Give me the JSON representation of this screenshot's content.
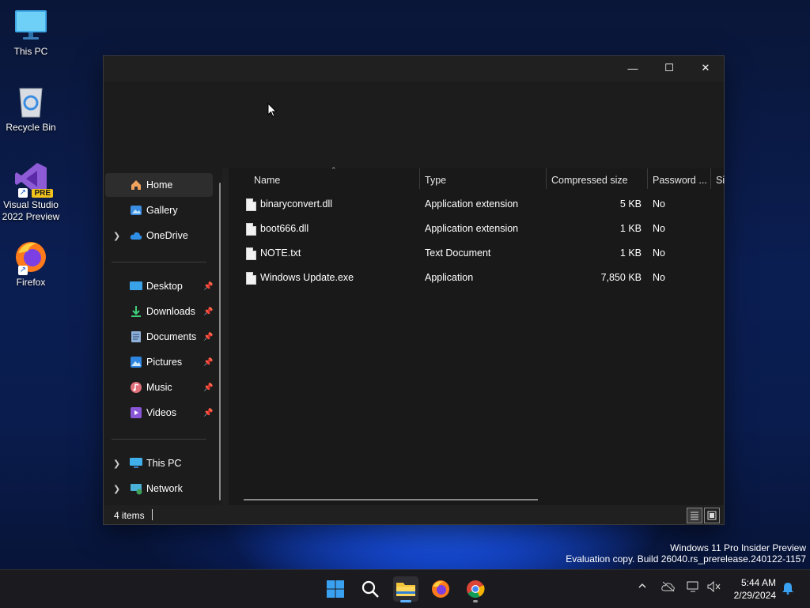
{
  "desktop": {
    "icons": [
      {
        "label_line1": "This PC",
        "label_line2": ""
      },
      {
        "label_line1": "Recycle Bin",
        "label_line2": ""
      },
      {
        "label_line1": "Visual Studio",
        "label_line2": "2022 Preview",
        "badge": "PRE"
      },
      {
        "label_line1": "Firefox",
        "label_line2": ""
      }
    ]
  },
  "window": {
    "controls": {
      "minimize": "—",
      "maximize": "☐",
      "close": "✕"
    },
    "nav": {
      "items": [
        {
          "label": "Home"
        },
        {
          "label": "Gallery"
        },
        {
          "label": "OneDrive"
        },
        {
          "label": "Desktop"
        },
        {
          "label": "Downloads"
        },
        {
          "label": "Documents"
        },
        {
          "label": "Pictures"
        },
        {
          "label": "Music"
        },
        {
          "label": "Videos"
        },
        {
          "label": "This PC"
        },
        {
          "label": "Network"
        }
      ]
    },
    "columns": {
      "name": "Name",
      "type": "Type",
      "compressed_size": "Compressed size",
      "password": "Password ...",
      "size": "Si"
    },
    "files": [
      {
        "name": "binaryconvert.dll",
        "type": "Application extension",
        "compressed_size": "5 KB",
        "password": "No"
      },
      {
        "name": "boot666.dll",
        "type": "Application extension",
        "compressed_size": "1 KB",
        "password": "No"
      },
      {
        "name": "NOTE.txt",
        "type": "Text Document",
        "compressed_size": "1 KB",
        "password": "No"
      },
      {
        "name": "Windows Update.exe",
        "type": "Application",
        "compressed_size": "7,850 KB",
        "password": "No"
      }
    ],
    "status": {
      "item_count": "4 items"
    }
  },
  "watermark": {
    "line1": "Windows 11 Pro Insider Preview",
    "line2": "Evaluation copy. Build 26040.rs_prerelease.240122-1157"
  },
  "taskbar": {
    "clock": {
      "time": "5:44 AM",
      "date": "2/29/2024"
    }
  },
  "colors": {
    "accent": "#5fb2ff",
    "window_bg": "#202020",
    "content_bg": "#191919"
  }
}
